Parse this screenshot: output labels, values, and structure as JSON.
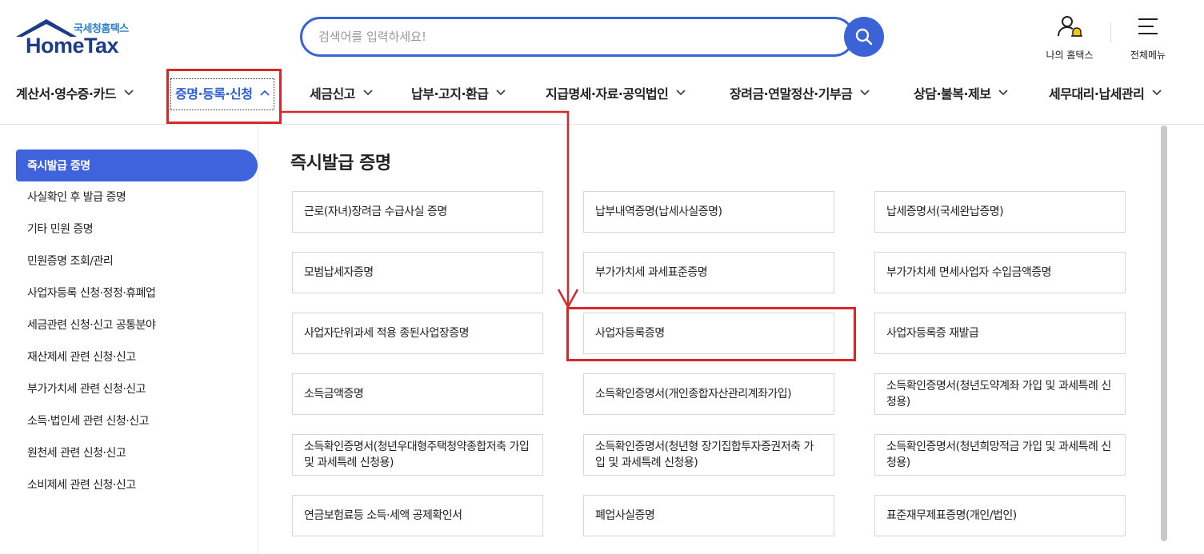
{
  "logo": {
    "korean": "국세청홈택스",
    "english": "HomeTax"
  },
  "search": {
    "placeholder": "검색어를 입력하세요!"
  },
  "utility": {
    "my_hometax": "나의 홈택스",
    "all_menu": "전체메뉴"
  },
  "gnb": [
    {
      "label": "계산서·영수증·카드"
    },
    {
      "label": "증명·등록·신청"
    },
    {
      "label": "세금신고"
    },
    {
      "label": "납부·고지·환급"
    },
    {
      "label": "지급명세·자료·공익법인"
    },
    {
      "label": "장려금·연말정산·기부금"
    },
    {
      "label": "상담·불복·제보"
    },
    {
      "label": "세무대리·납세관리"
    }
  ],
  "sidebar": {
    "items": [
      {
        "label": "즉시발급 증명"
      },
      {
        "label": "사실확인 후 발급 증명"
      },
      {
        "label": "기타 민원 증명"
      },
      {
        "label": "민원증명 조회/관리"
      },
      {
        "label": "사업자등록 신청·정정·휴폐업"
      },
      {
        "label": "세금관련 신청·신고 공통분야"
      },
      {
        "label": "재산제세 관련 신청·신고"
      },
      {
        "label": "부가가치세 관련 신청·신고"
      },
      {
        "label": "소득·법인세 관련 신청·신고"
      },
      {
        "label": "원천세 관련 신청·신고"
      },
      {
        "label": "소비제세 관련 신청·신고"
      }
    ]
  },
  "main": {
    "title": "즉시발급 증명",
    "cards": [
      {
        "label": "근로(자녀)장려금 수급사실 증명"
      },
      {
        "label": "납부내역증명(납세사실증명)"
      },
      {
        "label": "납세증명서(국세완납증명)"
      },
      {
        "label": "모범납세자증명"
      },
      {
        "label": "부가가치세 과세표준증명"
      },
      {
        "label": "부가가치세 면세사업자 수입금액증명"
      },
      {
        "label": "사업자단위과세 적용 종된사업장증명"
      },
      {
        "label": "사업자등록증명"
      },
      {
        "label": "사업자등록증 재발급"
      },
      {
        "label": "소득금액증명"
      },
      {
        "label": "소득확인증명서(개인종합자산관리계좌가입)"
      },
      {
        "label": "소득확인증명서(청년도약계좌 가입 및 과세특례 신청용)"
      },
      {
        "label": "소득확인증명서(청년우대형주택청약종합저축 가입 및 과세특례 신청용)"
      },
      {
        "label": "소득확인증명서(청년형 장기집합투자증권저축 가입 및 과세특례 신청용)"
      },
      {
        "label": "소득확인증명서(청년희망적금 가입 및 과세특례 신청용)"
      },
      {
        "label": "연금보험료등 소득·세액 공제확인서"
      },
      {
        "label": "폐업사실증명"
      },
      {
        "label": "표준재무제표증명(개인/법인)"
      }
    ]
  },
  "colors": {
    "brand_blue": "#3a63d8",
    "annotation_red": "#d62828"
  }
}
